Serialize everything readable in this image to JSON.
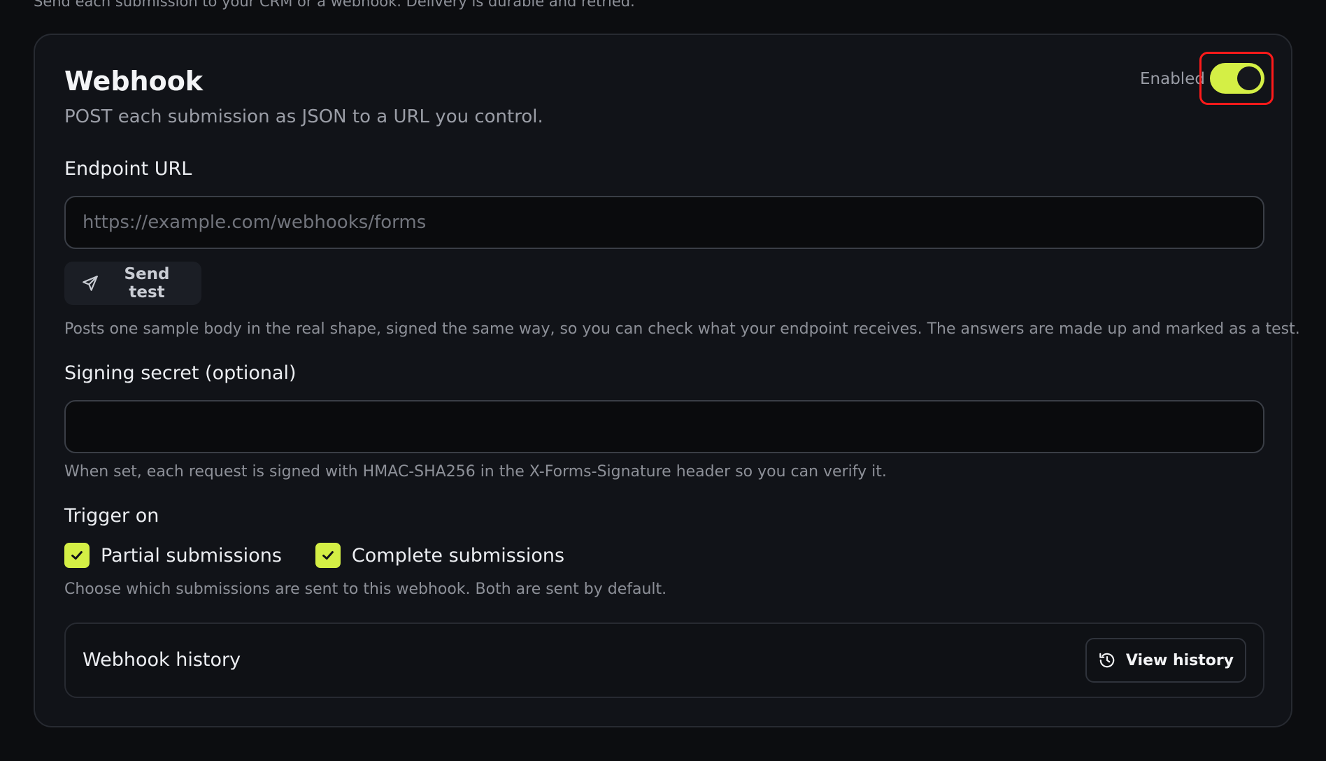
{
  "intro": {
    "text": "Send each submission to your CRM or a webhook. Delivery is durable and retried."
  },
  "webhook": {
    "title": "Webhook",
    "subtitle": "POST each submission as JSON to a URL you control.",
    "enabled_label": "Enabled",
    "enabled": true,
    "endpoint": {
      "label": "Endpoint URL",
      "placeholder": "https://example.com/webhooks/forms",
      "value": ""
    },
    "send_test": {
      "label": "Send test",
      "icon": "send-icon",
      "help": "Posts one sample body in the real shape, signed the same way, so you can check what your endpoint receives. The answers are made up and marked as a test."
    },
    "secret": {
      "label": "Signing secret (optional)",
      "value": "",
      "help": "When set, each request is signed with HMAC-SHA256 in the X-Forms-Signature header so you can verify it."
    },
    "trigger": {
      "label": "Trigger on",
      "options": [
        {
          "label": "Partial submissions",
          "checked": true
        },
        {
          "label": "Complete submissions",
          "checked": true
        }
      ],
      "help": "Choose which submissions are sent to this webhook. Both are sent by default."
    },
    "history": {
      "title": "Webhook history",
      "button_label": "View history",
      "button_icon": "history-icon"
    }
  },
  "colors": {
    "accent": "#d4ef45",
    "background": "#0c0d10",
    "card": "#111318",
    "highlight": "#ff1a1a"
  }
}
